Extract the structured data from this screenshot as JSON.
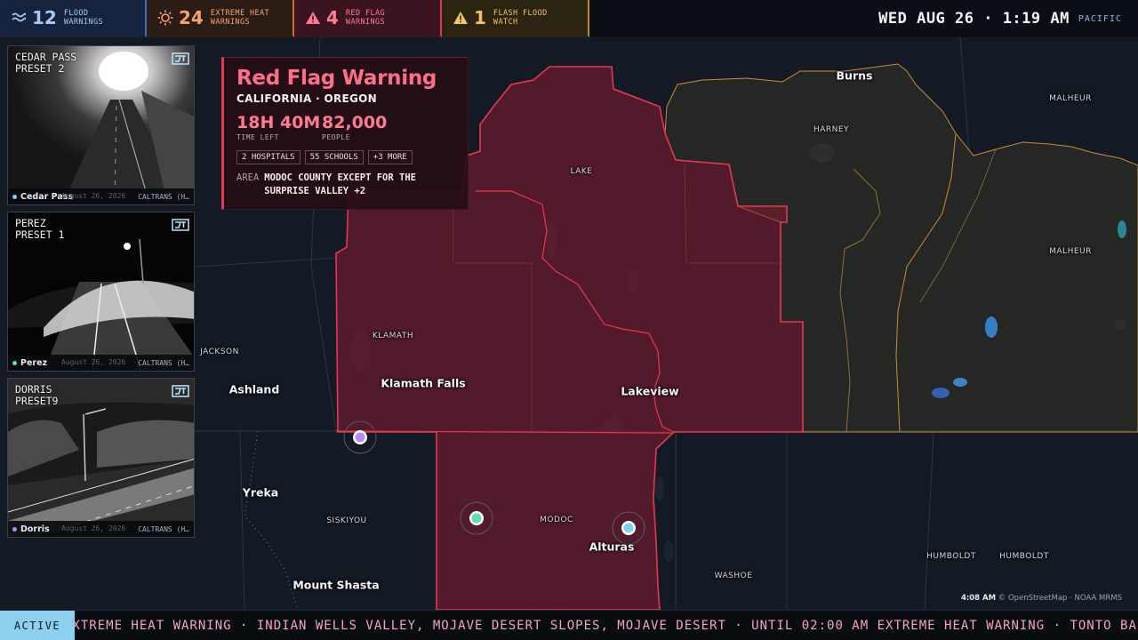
{
  "topbar": {
    "tabs": [
      {
        "count": "12",
        "label_1": "FLOOD",
        "label_2": "WARNINGS",
        "icon": "waves-icon"
      },
      {
        "count": "24",
        "label_1": "EXTREME HEAT",
        "label_2": "WARNINGS",
        "icon": "sun-icon"
      },
      {
        "count": "4",
        "label_1": "RED FLAG",
        "label_2": "WARNINGS",
        "icon": "warning-triangle-icon"
      },
      {
        "count": "1",
        "label_1": "FLASH FLOOD",
        "label_2": "WATCH",
        "icon": "warning-triangle-icon"
      }
    ],
    "clock": "WED AUG 26 · 1:19 AM",
    "timezone": "PACIFIC"
  },
  "cameras": [
    {
      "title": "CEDAR PASS\nPRESET 2",
      "name": "Cedar Pass",
      "source": "CALTRANS (H…",
      "stamp": "August 26, 2026",
      "dot_color": "#7fd0f0"
    },
    {
      "title": "PEREZ\nPRESET 1",
      "name": "Perez",
      "source": "CALTRANS (H…",
      "stamp": "August 26, 2026",
      "dot_color": "#5fe0a8"
    },
    {
      "title": "DORRIS\nPRESET9",
      "name": "Dorris",
      "source": "CALTRANS (H…",
      "stamp": "August 26, 2026",
      "dot_color": "#b58cff"
    }
  ],
  "card": {
    "title": "Red Flag Warning",
    "region": "CALIFORNIA · OREGON",
    "time_left_value": "18H 40M",
    "time_left_label": "TIME LEFT",
    "people_value": "82,000",
    "people_label": "PEOPLE",
    "chips": [
      "2 HOSPITALS",
      "55 SCHOOLS",
      "+3 MORE"
    ],
    "area_label": "AREA",
    "area_value": "MODOC COUNTY EXCEPT FOR THE SURPRISE VALLEY +2"
  },
  "map": {
    "cities": [
      "Burns",
      "Klamath Falls",
      "Lakeview",
      "Ashland",
      "Yreka",
      "Alturas",
      "Mount Shasta"
    ],
    "counties": [
      "HARNEY",
      "MALHEUR",
      "MALHEUR",
      "LAKE",
      "KLAMATH",
      "JACKSON",
      "SISKIYOU",
      "MODOC",
      "WASHOE",
      "HUMBOLDT",
      "HUMBOLDT"
    ],
    "warning_color": "#e03a57",
    "heat_color": "#c98a3a"
  },
  "attribution": {
    "time": "4:08 AM",
    "text": "© OpenStreetMap · NOAA MRMS"
  },
  "ticker": {
    "status": "ACTIVE",
    "text": "EXTREME HEAT WARNING · INDIAN WELLS VALLEY, MOJAVE DESERT SLOPES, MOJAVE DESERT · UNTIL 02:00 AM    EXTREME HEAT WARNING · TONTO BASIN"
  }
}
